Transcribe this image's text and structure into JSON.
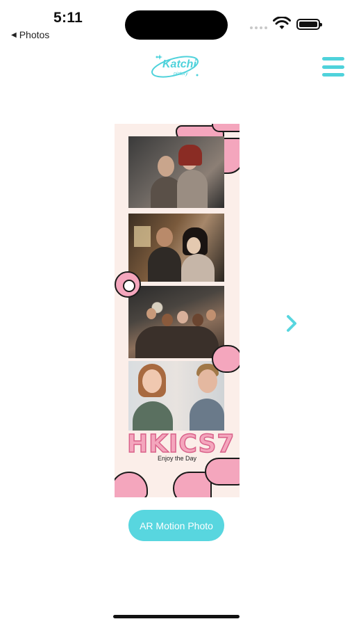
{
  "status_bar": {
    "time": "5:11",
    "back_app": "Photos",
    "back_icon": "triangle-left-icon"
  },
  "header": {
    "logo_text": "Katchi",
    "logo_sub": "pictory",
    "menu_icon": "hamburger-menu-icon"
  },
  "photo_strip": {
    "title": "HKICS7",
    "tagline": "Enjoy the Day",
    "photo_count": 4
  },
  "navigation": {
    "next_icon": "chevron-right-icon"
  },
  "actions": {
    "ar_button_label": "AR Motion Photo"
  },
  "colors": {
    "accent": "#58d6df",
    "strip_background": "#fbeee9",
    "pink": "#f4a6bd"
  }
}
